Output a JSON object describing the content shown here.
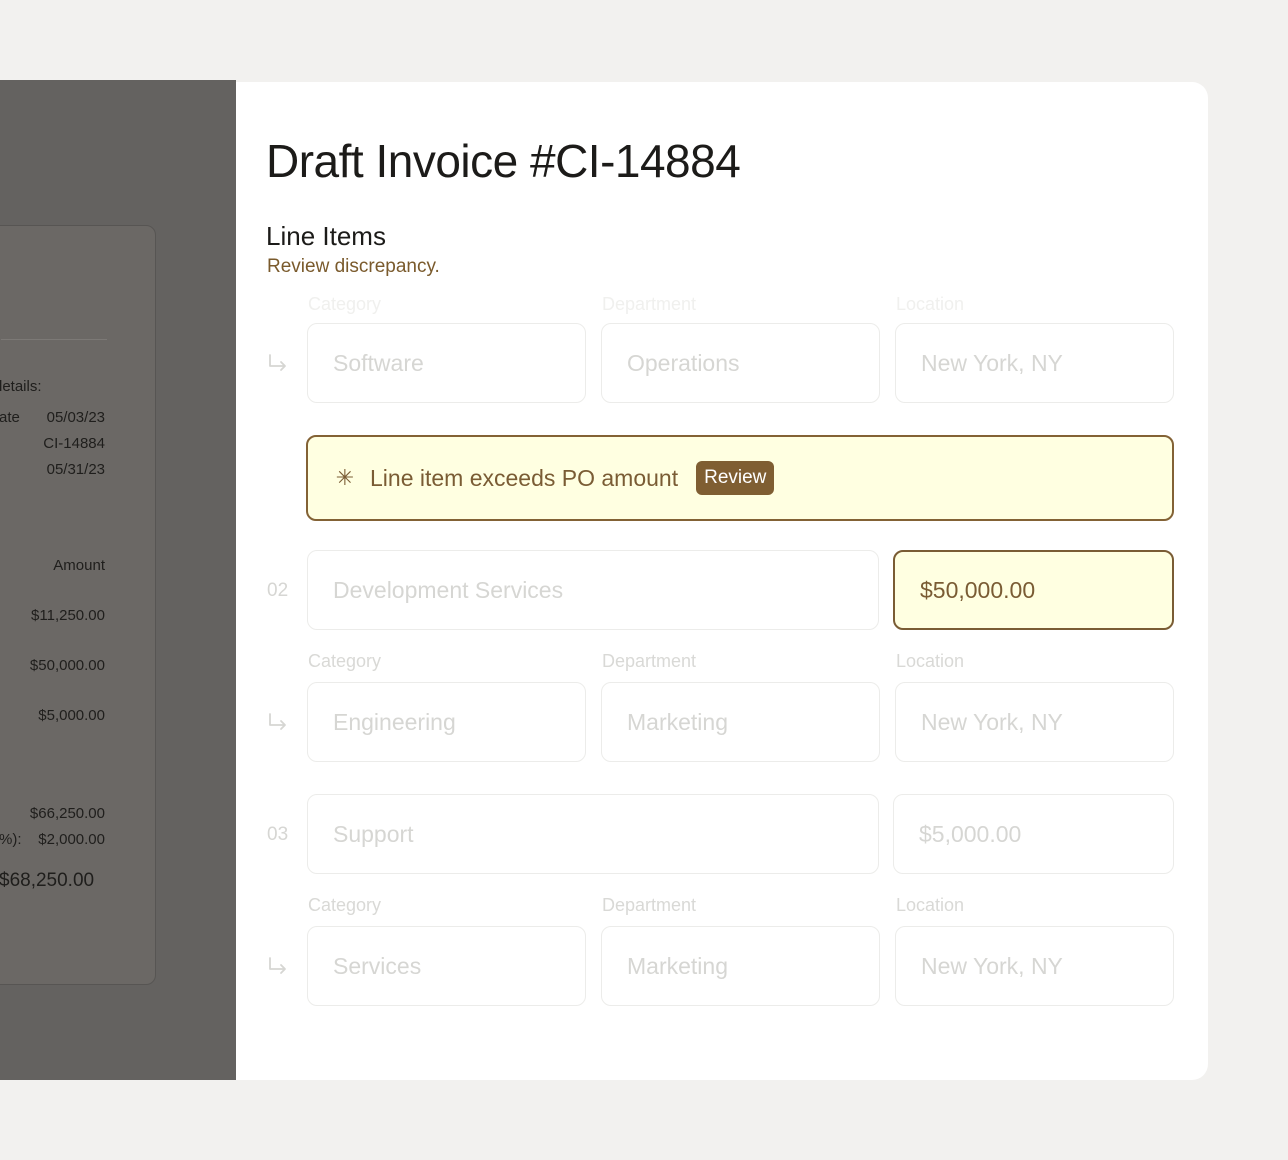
{
  "background_invoice": {
    "details_label": "letails:",
    "rows": [
      {
        "label": "ate",
        "value": "05/03/23"
      },
      {
        "label": "",
        "value": "CI-14884"
      },
      {
        "label": "",
        "value": "05/31/23"
      }
    ],
    "amount_header": "Amount",
    "amounts": [
      "$11,250.00",
      "$50,000.00",
      "$5,000.00"
    ],
    "subtotal": "$66,250.00",
    "tax_label": "%):",
    "tax": "$2,000.00",
    "total": "$68,250.00"
  },
  "panel": {
    "title": "Draft Invoice #CI-14884",
    "section_title": "Line Items",
    "section_subtitle": "Review discrepancy."
  },
  "labels": {
    "category": "Category",
    "department": "Department",
    "location": "Location"
  },
  "line_items": [
    {
      "category": "Software",
      "department": "Operations",
      "location": "New York, NY"
    },
    {
      "number": "02",
      "description": "Development Services",
      "amount": "$50,000.00",
      "category": "Engineering",
      "department": "Marketing",
      "location": "New York, NY"
    },
    {
      "number": "03",
      "description": "Support",
      "amount": "$5,000.00",
      "category": "Services",
      "department": "Marketing",
      "location": "New York, NY"
    }
  ],
  "alert": {
    "icon": "asterisk-icon",
    "message": "Line item exceeds PO amount",
    "action": "Review"
  },
  "colors": {
    "accent": "#7f5e32",
    "alert_bg": "#ffffe1",
    "overlay": "#646260"
  }
}
